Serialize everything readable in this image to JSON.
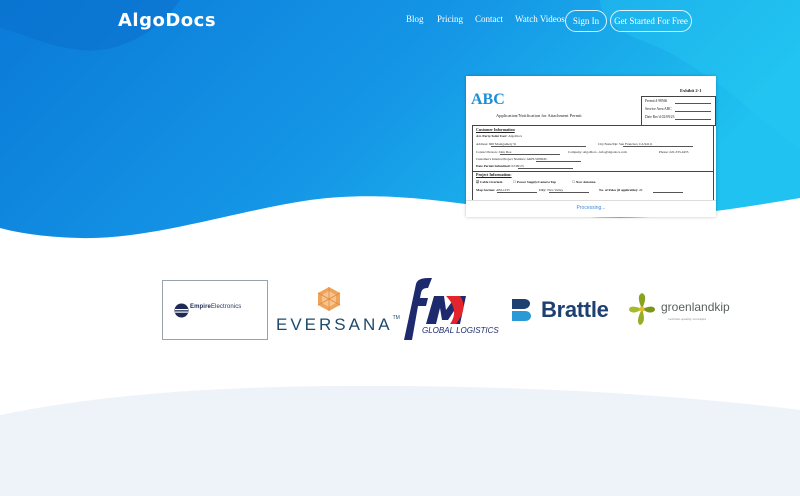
{
  "brand": {
    "logo_text": "AlgoDocs"
  },
  "nav": {
    "blog": "Blog",
    "pricing": "Pricing",
    "contact": "Contact",
    "watch_videos": "Watch Videos",
    "sign_in": "Sign In",
    "get_started": "Get Started For Free"
  },
  "colors": {
    "hero_gradient_start": "#0a7ad8",
    "hero_gradient_end": "#1fc2f0",
    "bottom_wave": "#eef3fa",
    "doc_heading": "#1b8fd6",
    "processing_text": "#3f8bd6"
  },
  "document_preview": {
    "logo": "ABC",
    "title": "Application/Notification for Attachment Permit",
    "exhibit": "Exhibit 2-1",
    "permit_label": "Permit #",
    "permit_value": "98566",
    "service_area_label": "Service Area",
    "service_area_value": "ABC",
    "date_recd_label": "Date Rec'd",
    "date_recd_value": "02/09/23",
    "customer_section": "Customer Information",
    "party_label": "Att. Party/Joint User:",
    "party_value": "AlgoDocs",
    "address_label": "Address:",
    "address_value": "600 Montgomery St",
    "city_label": "City/State/Zip:",
    "city_value": "San Francisco CA 94111",
    "contact_label": "Contact Person:",
    "contact_value": "John Doe",
    "company_label": "Company:",
    "company_value": "AlgoDocs",
    "email_value": "info@algodocs.com",
    "phone_label": "Phone:",
    "phone_value": "222-333-4455",
    "internal_label": "Customer's Internal Project Number:",
    "internal_value": "AKH-505843C",
    "date_submitted_label": "Date Permit Submitted:",
    "date_submitted_value": "02/09/23",
    "project_section": "Project Information:",
    "opt1": "Cable Overlash",
    "opt2": "Power Supply/Camera Tap",
    "opt3": "New Antenna",
    "map_label": "Map Section:",
    "map_value": "ABI-1235",
    "city2_label": "City:",
    "city2_value": "Nice Valley",
    "poles_label": "No. of Poles (if applicable):",
    "poles_value": "26",
    "processing": "Processing..."
  },
  "clients": {
    "empire": {
      "name_bold": "Empire",
      "name_rest": "Electronics"
    },
    "eversana": {
      "name": "EVERSANA",
      "tm": "TM"
    },
    "fm": {
      "name": "GLOBAL LOGISTICS"
    },
    "brattle": {
      "name": "Brattle"
    },
    "groenland": {
      "name": "groenlandkip",
      "tagline": "nutrition quality concepts"
    }
  }
}
